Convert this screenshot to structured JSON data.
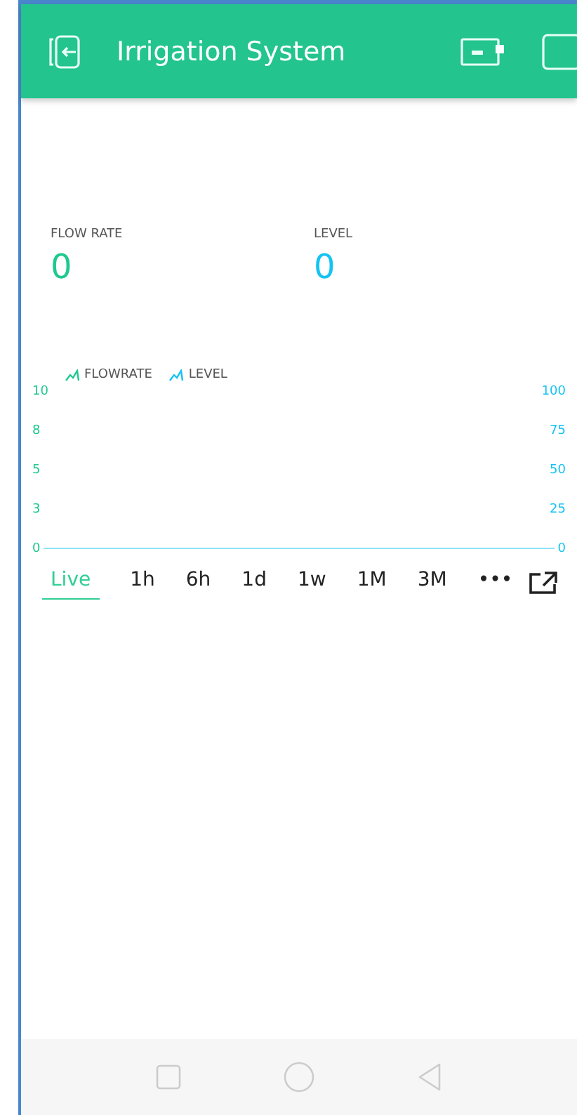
{
  "header": {
    "title": "Irrigation System"
  },
  "widgets": [
    {
      "label": "FLOW RATE",
      "value": "0",
      "color": "#1fc98e"
    },
    {
      "label": "LEVEL",
      "value": "0",
      "color": "#14c3f2"
    }
  ],
  "chart": {
    "legend": [
      {
        "name": "FLOWRATE",
        "color": "#1fc98e"
      },
      {
        "name": "LEVEL",
        "color": "#14c3f2"
      }
    ],
    "left_ticks": [
      "10",
      "8",
      "5",
      "3",
      "0"
    ],
    "right_ticks": [
      "100",
      "75",
      "50",
      "25",
      "0"
    ],
    "ranges": [
      {
        "label": "Live",
        "selected": true
      },
      {
        "label": "1h",
        "selected": false
      },
      {
        "label": "6h",
        "selected": false
      },
      {
        "label": "1d",
        "selected": false
      },
      {
        "label": "1w",
        "selected": false
      },
      {
        "label": "1M",
        "selected": false
      },
      {
        "label": "3M",
        "selected": false
      },
      {
        "label": "•••",
        "selected": false
      }
    ]
  }
}
